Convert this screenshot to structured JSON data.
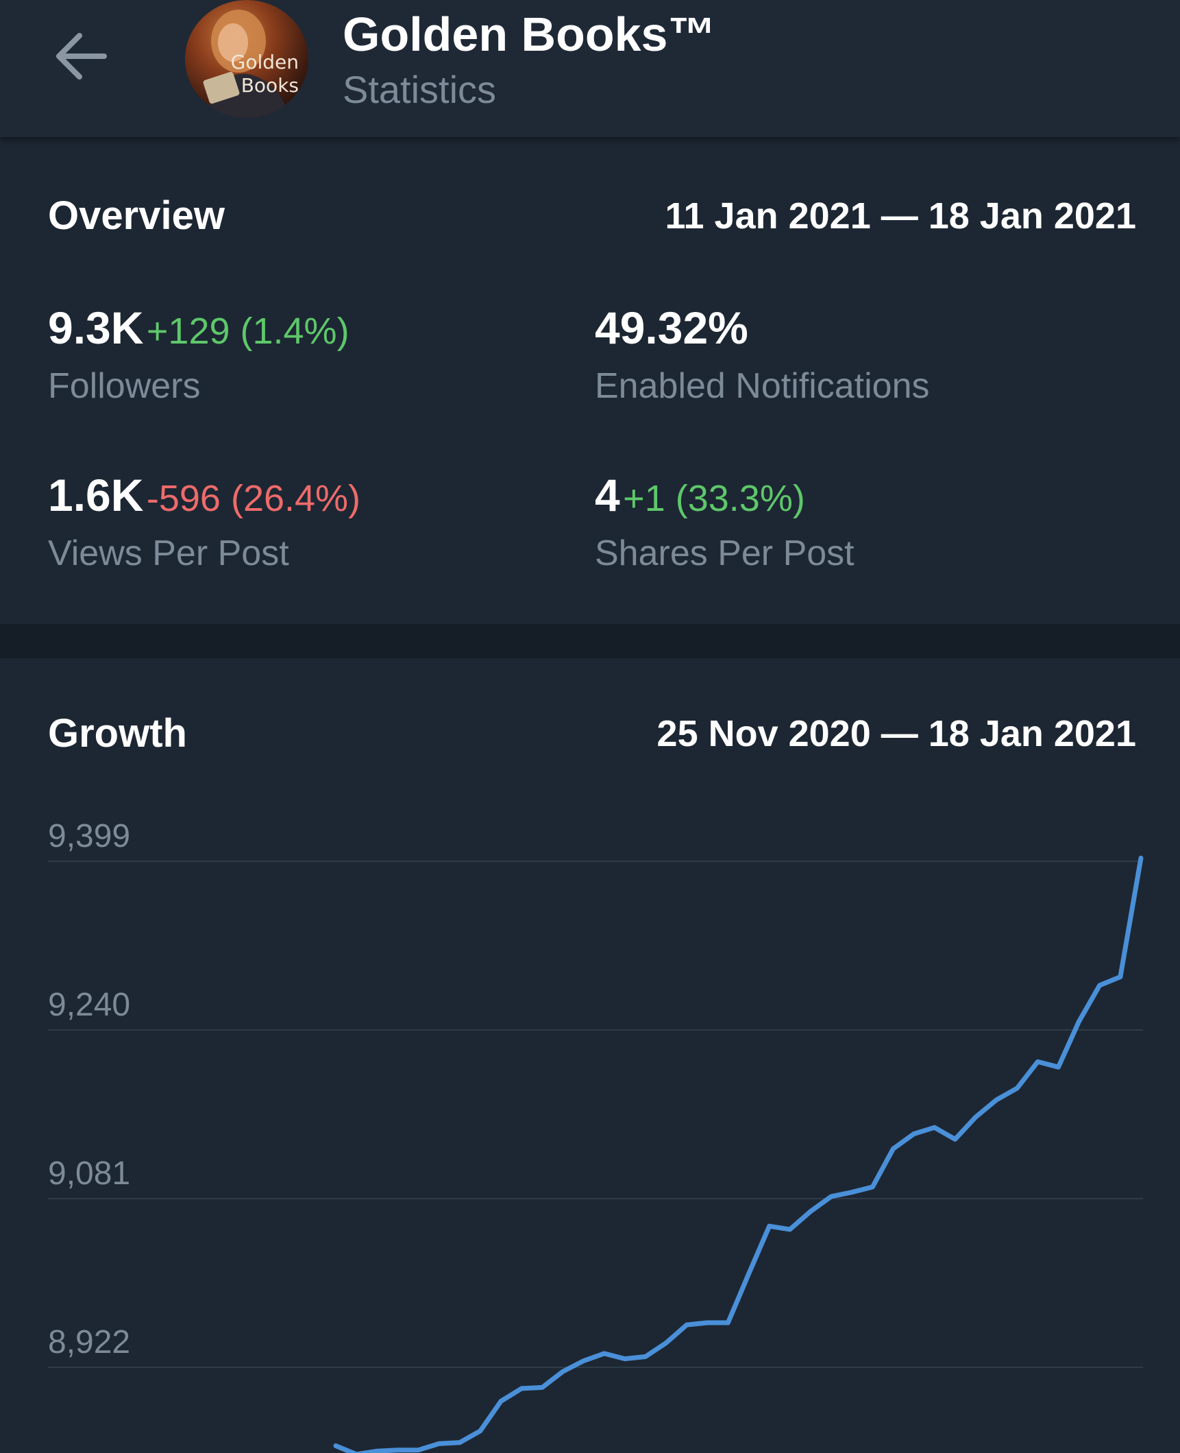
{
  "header": {
    "title": "Golden Books™",
    "subtitle": "Statistics",
    "avatar_text_line1": "Golden",
    "avatar_text_line2": "Books"
  },
  "overview": {
    "title": "Overview",
    "range": "11 Jan 2021 — 18 Jan 2021",
    "stats": [
      {
        "value": "9.3K",
        "delta": "+129 (1.4%)",
        "direction": "up",
        "label": "Followers"
      },
      {
        "value": "49.32%",
        "delta": "",
        "direction": "none",
        "label": "Enabled Notifications"
      },
      {
        "value": "1.6K",
        "delta": "-596 (26.4%)",
        "direction": "down",
        "label": "Views Per Post"
      },
      {
        "value": "4",
        "delta": "+1 (33.3%)",
        "direction": "up",
        "label": "Shares Per Post"
      }
    ]
  },
  "growth": {
    "title": "Growth",
    "range": "25 Nov 2020 — 18 Jan 2021"
  },
  "colors": {
    "background": "#1d2733",
    "line": "#4a90d9",
    "positive": "#5ec86a",
    "negative": "#ee6b6b",
    "muted": "#7d8b99"
  },
  "chart_data": {
    "type": "line",
    "title": "Growth",
    "ylim": [
      8840,
      9399
    ],
    "yticks": [
      "9,399",
      "9,240",
      "9,081",
      "8,922"
    ],
    "ytick_values": [
      9399,
      9240,
      9081,
      8922
    ],
    "grid": true,
    "series": [
      {
        "values": [
          8848,
          8840,
          8843,
          8844,
          8844,
          8850,
          8851,
          8862,
          8890,
          8902,
          8903,
          8918,
          8928,
          8935,
          8930,
          8932,
          8945,
          8962,
          8964,
          8964,
          9010,
          9055,
          9052,
          9069,
          9083,
          9087,
          9092,
          9128,
          9142,
          9148,
          9137,
          9158,
          9174,
          9185,
          9210,
          9205,
          9248,
          9282,
          9290,
          9402
        ]
      }
    ],
    "visible_tail_values": [
      9205,
      9249,
      9282,
      9290,
      9300,
      9399
    ]
  }
}
